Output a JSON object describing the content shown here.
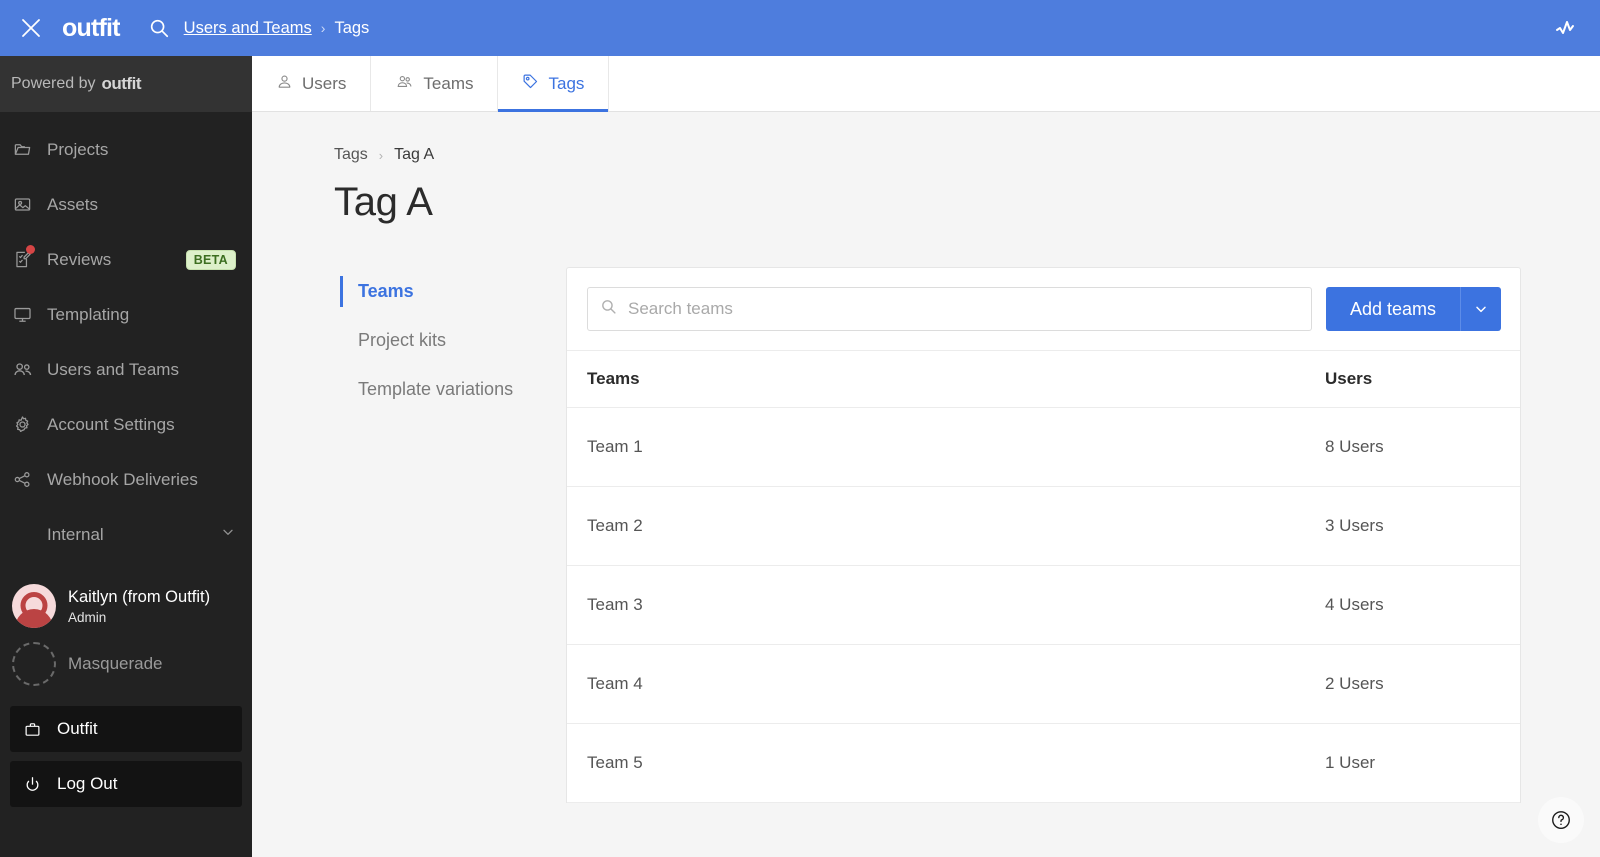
{
  "topbar": {
    "close_label": "close-icon",
    "brand": "outfit",
    "breadcrumb_link": "Users and Teams",
    "breadcrumb_sep": "›",
    "breadcrumb_current": "Tags",
    "accent_color": "#4e7ddd"
  },
  "sidebar": {
    "powered_prefix": "Powered by",
    "powered_brand": "outfit",
    "items": [
      {
        "label": "Projects",
        "icon": "folder-icon",
        "badge": null,
        "dot": false
      },
      {
        "label": "Assets",
        "icon": "image-icon",
        "badge": null,
        "dot": false
      },
      {
        "label": "Reviews",
        "icon": "review-icon",
        "badge": "BETA",
        "dot": true
      },
      {
        "label": "Templating",
        "icon": "monitor-icon",
        "badge": null,
        "dot": false
      },
      {
        "label": "Users and Teams",
        "icon": "users-icon",
        "badge": null,
        "dot": false
      },
      {
        "label": "Account Settings",
        "icon": "gear-icon",
        "badge": null,
        "dot": false
      },
      {
        "label": "Webhook Deliveries",
        "icon": "share-icon",
        "badge": null,
        "dot": false
      }
    ],
    "group_label": "Internal",
    "user": {
      "name": "Kaitlyn (from Outfit)",
      "role": "Admin"
    },
    "masquerade_label": "Masquerade",
    "bottom_buttons": [
      {
        "label": "Outfit",
        "icon": "briefcase-icon"
      },
      {
        "label": "Log Out",
        "icon": "power-icon"
      }
    ],
    "badge_bg": "#ddf0ca",
    "badge_fg": "#3c6e20"
  },
  "tabs": [
    {
      "label": "Users",
      "icon": "user-icon",
      "active": false
    },
    {
      "label": "Teams",
      "icon": "team-icon",
      "active": false
    },
    {
      "label": "Tags",
      "icon": "tag-icon",
      "active": true
    }
  ],
  "page": {
    "breadcrumb_root": "Tags",
    "breadcrumb_sep": "›",
    "breadcrumb_current": "Tag A",
    "title": "Tag A",
    "accent_color": "#3c73e0"
  },
  "subnav": [
    {
      "label": "Teams",
      "active": true
    },
    {
      "label": "Project kits",
      "active": false
    },
    {
      "label": "Template variations",
      "active": false
    }
  ],
  "panel": {
    "search_placeholder": "Search teams",
    "search_value": "",
    "add_button_label": "Add teams",
    "add_button_caret": "chevron-down-icon",
    "columns": [
      "Teams",
      "Users"
    ],
    "rows": [
      {
        "team": "Team 1",
        "users": "8 Users"
      },
      {
        "team": "Team 2",
        "users": "3 Users"
      },
      {
        "team": "Team 3",
        "users": "4 Users"
      },
      {
        "team": "Team 4",
        "users": "2 Users"
      },
      {
        "team": "Team 5",
        "users": "1 User"
      }
    ]
  },
  "help": {
    "icon": "help-icon",
    "label": "?"
  }
}
